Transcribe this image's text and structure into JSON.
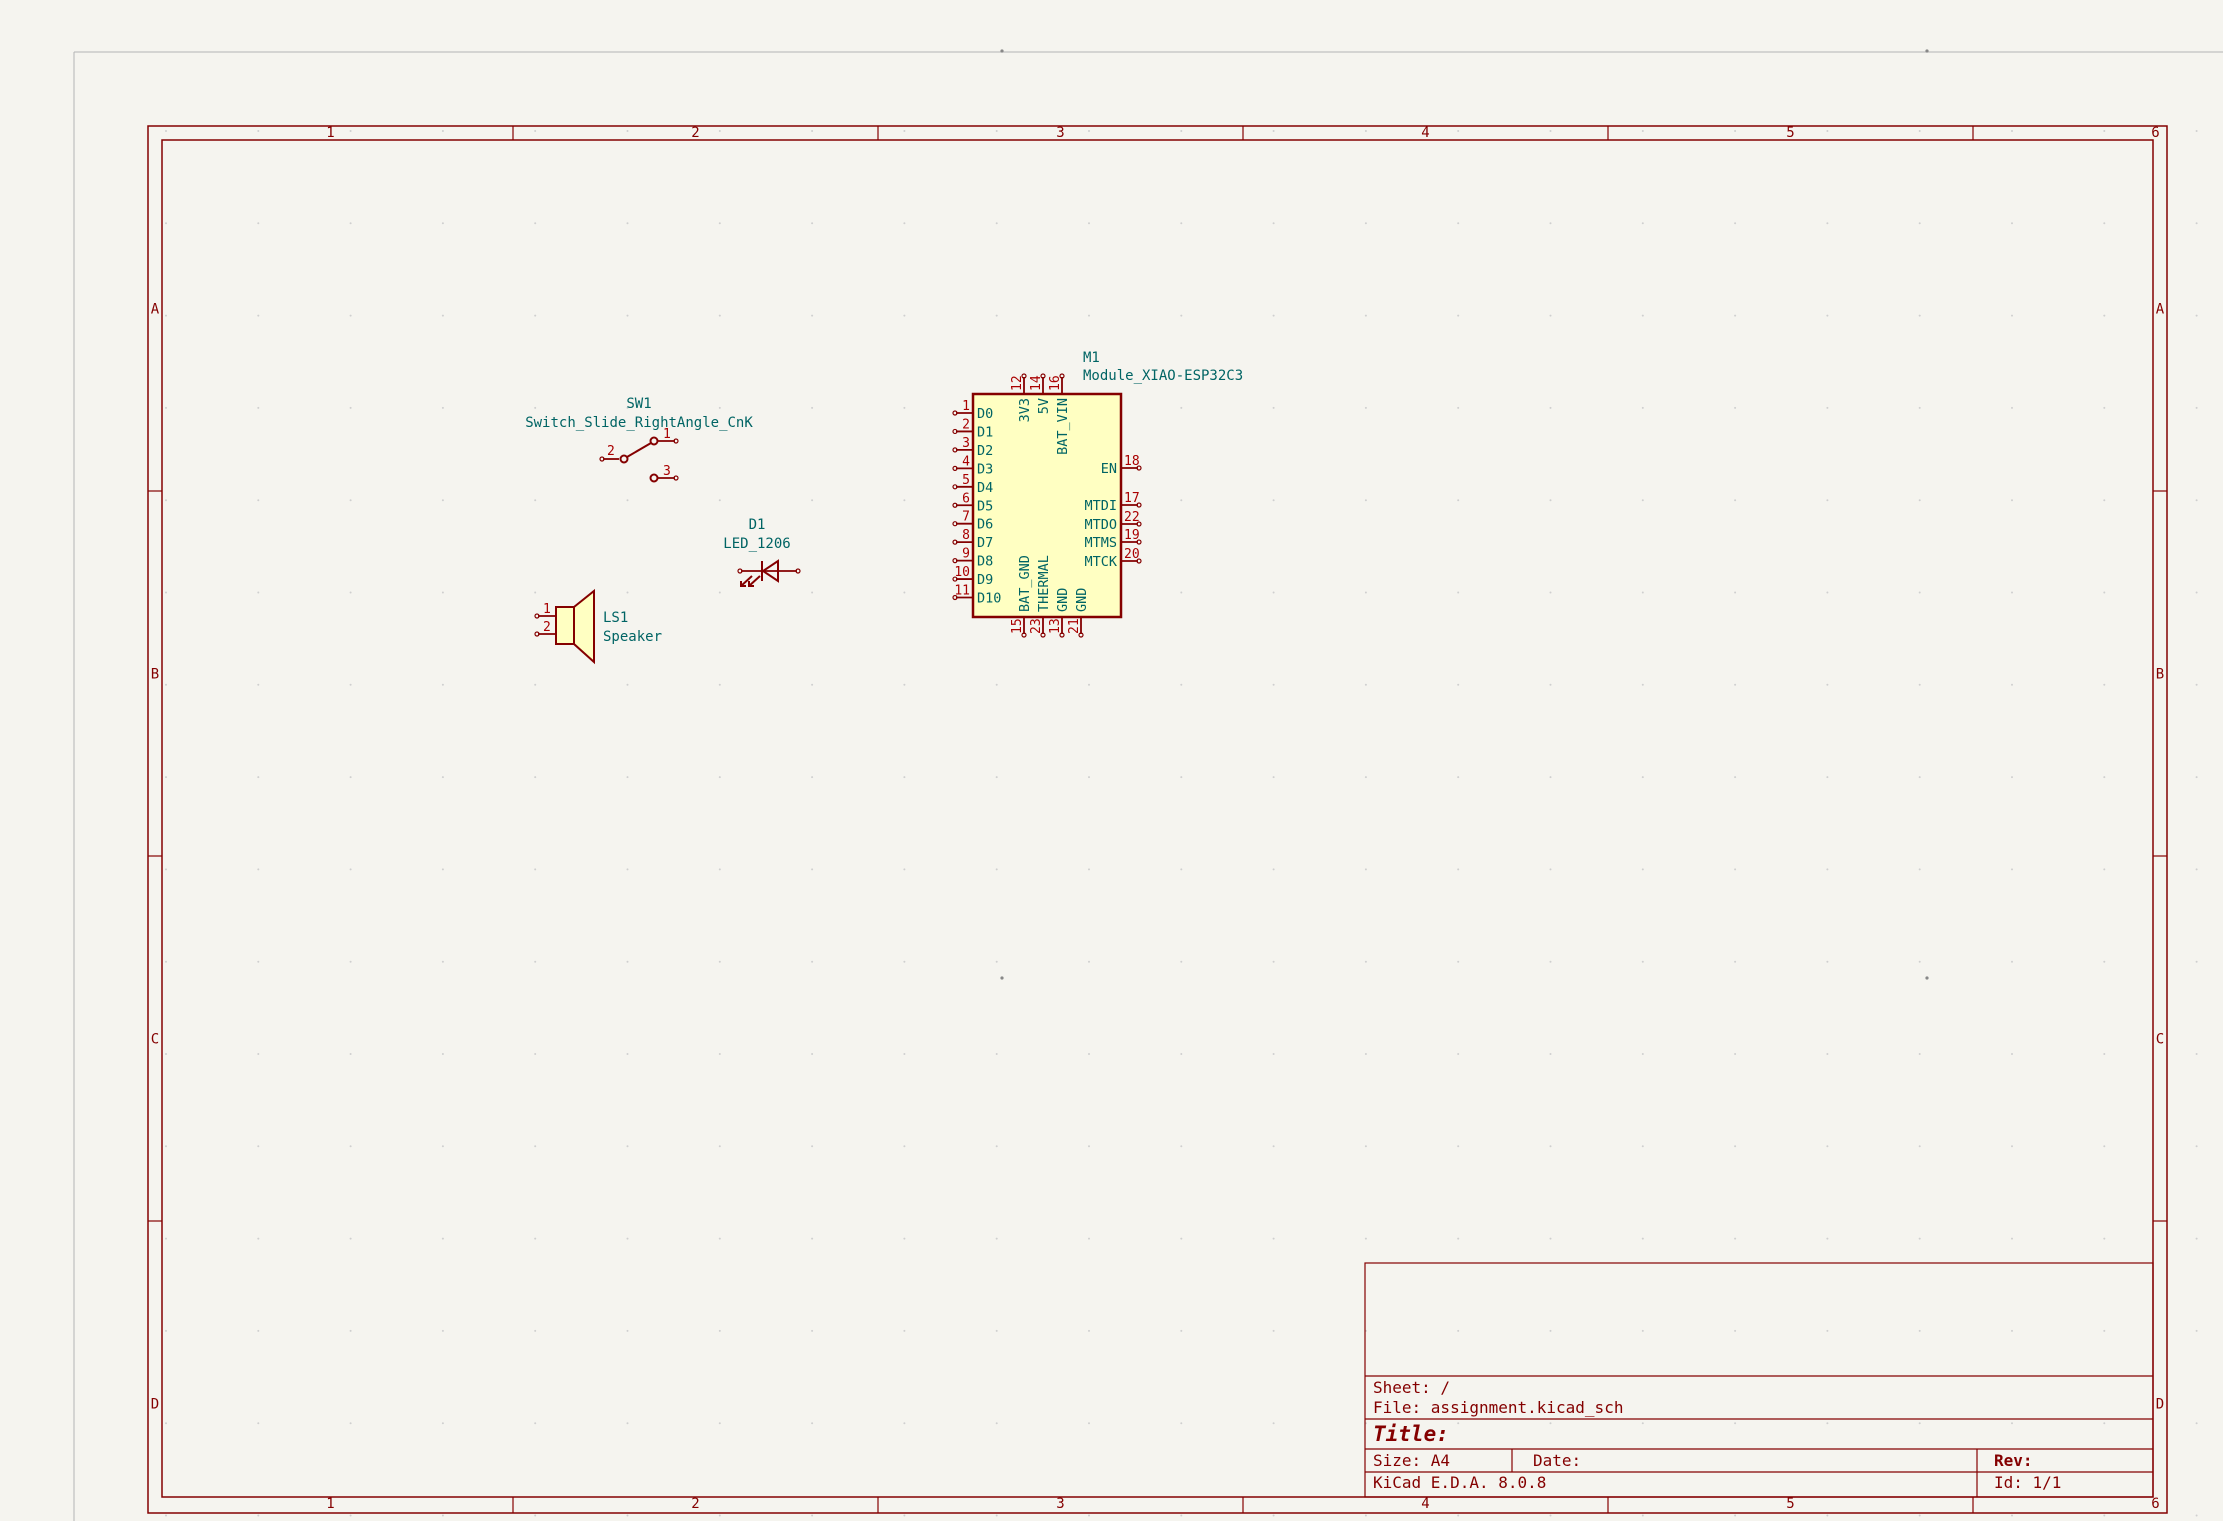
{
  "sheet": {
    "columns": [
      "1",
      "2",
      "3",
      "4",
      "5",
      "6"
    ],
    "rows": [
      "A",
      "B",
      "C",
      "D"
    ]
  },
  "title_block": {
    "sheet_label": "Sheet: /",
    "file_label": "File: assignment.kicad_sch",
    "title_label": "Title:",
    "size_label": "Size: A4",
    "date_label": "Date:",
    "rev_label": "Rev:",
    "tool_label": "KiCad E.D.A. 8.0.8",
    "id_label": "Id: 1/1"
  },
  "components": {
    "sw1": {
      "ref": "SW1",
      "value": "Switch_Slide_RightAngle_CnK",
      "pins": [
        "1",
        "2",
        "3"
      ]
    },
    "d1": {
      "ref": "D1",
      "value": "LED_1206"
    },
    "ls1": {
      "ref": "LS1",
      "value": "Speaker",
      "pins": [
        "1",
        "2"
      ]
    },
    "m1": {
      "ref": "M1",
      "value": "Module_XIAO-ESP32C3",
      "left_pins": [
        {
          "num": "1",
          "name": "D0"
        },
        {
          "num": "2",
          "name": "D1"
        },
        {
          "num": "3",
          "name": "D2"
        },
        {
          "num": "4",
          "name": "D3"
        },
        {
          "num": "5",
          "name": "D4"
        },
        {
          "num": "6",
          "name": "D5"
        },
        {
          "num": "7",
          "name": "D6"
        },
        {
          "num": "8",
          "name": "D7"
        },
        {
          "num": "9",
          "name": "D8"
        },
        {
          "num": "10",
          "name": "D9"
        },
        {
          "num": "11",
          "name": "D10"
        }
      ],
      "top_pins": [
        {
          "num": "12",
          "name": "3V3"
        },
        {
          "num": "14",
          "name": "5V"
        },
        {
          "num": "16",
          "name": "BAT_VIN"
        }
      ],
      "right_pins": [
        {
          "num": "18",
          "name": "EN"
        },
        {
          "num": "17",
          "name": "MTDI"
        },
        {
          "num": "22",
          "name": "MTDO"
        },
        {
          "num": "19",
          "name": "MTMS"
        },
        {
          "num": "20",
          "name": "MTCK"
        }
      ],
      "bottom_pins": [
        {
          "num": "15",
          "name": "BAT_GND"
        },
        {
          "num": "23",
          "name": "THERMAL"
        },
        {
          "num": "13",
          "name": "GND"
        },
        {
          "num": "21",
          "name": "GND"
        }
      ]
    }
  }
}
